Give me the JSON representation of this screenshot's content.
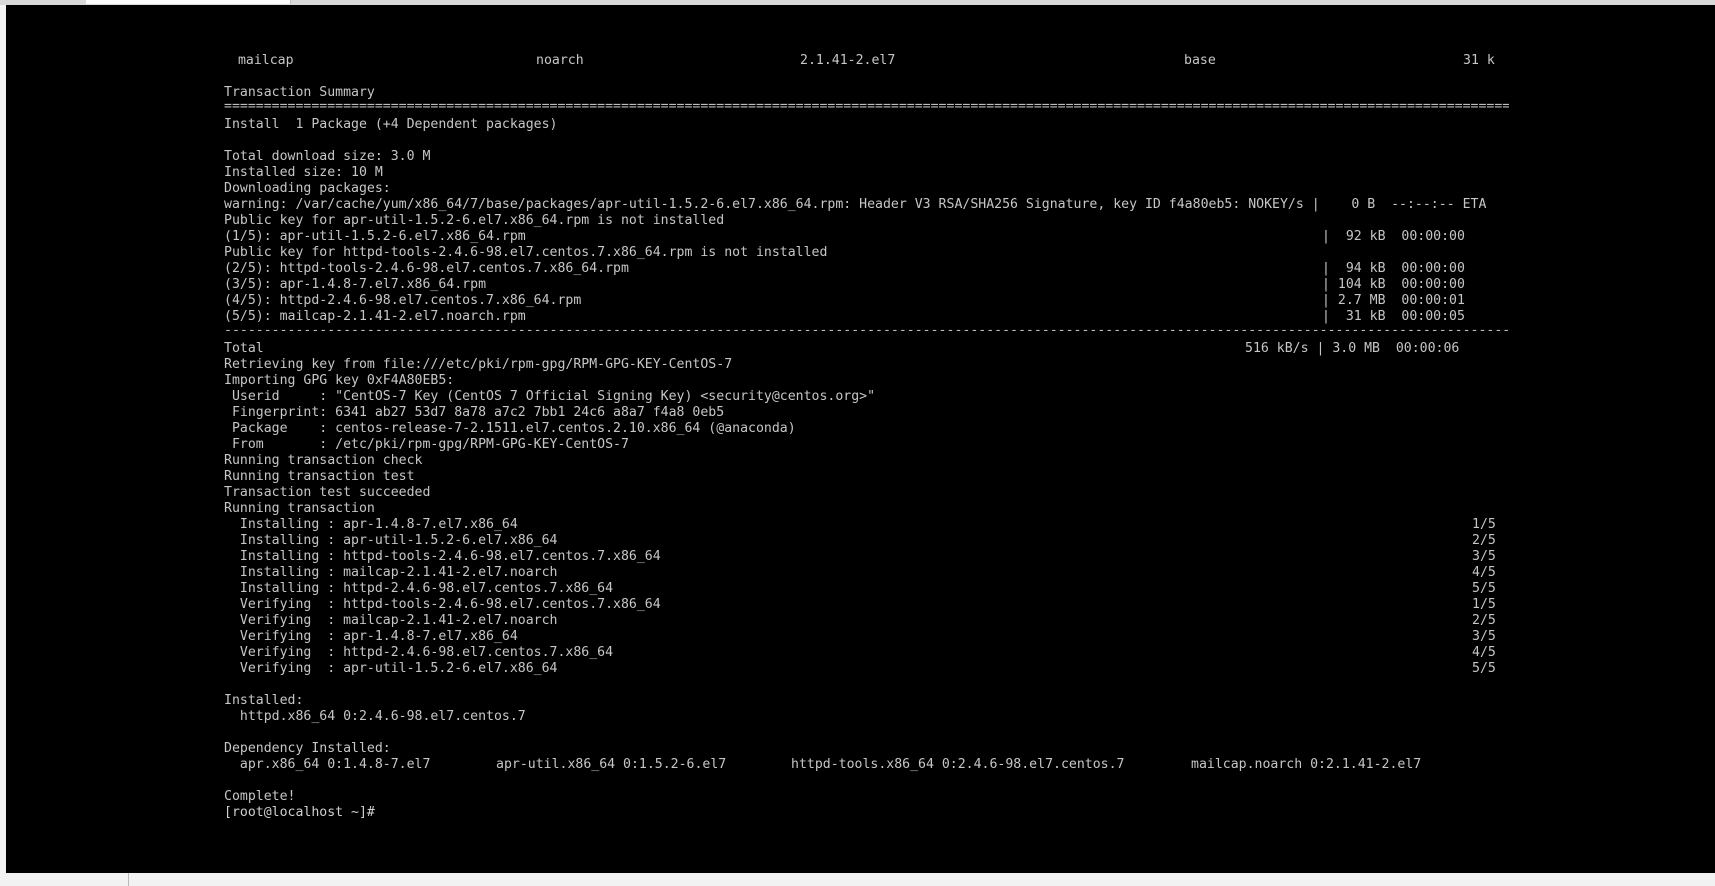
{
  "console": {
    "pkg_row": {
      "name": " mailcap",
      "arch": "noarch",
      "version": "2.1.41-2.el7",
      "repo": "base",
      "size": "31 k"
    },
    "transaction_summary": "Transaction Summary",
    "equals_rule": "==================================================================================================================================================================================================",
    "install_line": "Install  1 Package (+4 Dependent packages)",
    "total_download": "Total download size: 3.0 M",
    "installed_size": "Installed size: 10 M",
    "downloading": "Downloading packages:",
    "warning_line": "warning: /var/cache/yum/x86_64/7/base/packages/apr-util-1.5.2-6.el7.x86_64.rpm: Header V3 RSA/SHA256 Signature, key ID f4a80eb5: NOKEY/s |    0 B  --:--:-- ETA",
    "pubkey_apr_util": "Public key for apr-util-1.5.2-6.el7.x86_64.rpm is not installed",
    "pubkey_httpd_tools": "Public key for httpd-tools-2.4.6-98.el7.centos.7.x86_64.rpm is not installed",
    "downloads": [
      {
        "file": "(1/5): apr-util-1.5.2-6.el7.x86_64.rpm",
        "stat": "|  92 kB  00:00:00"
      },
      {
        "file": "(2/5): httpd-tools-2.4.6-98.el7.centos.7.x86_64.rpm",
        "stat": "|  94 kB  00:00:00"
      },
      {
        "file": "(3/5): apr-1.4.8-7.el7.x86_64.rpm",
        "stat": "| 104 kB  00:00:00"
      },
      {
        "file": "(4/5): httpd-2.4.6-98.el7.centos.7.x86_64.rpm",
        "stat": "| 2.7 MB  00:00:01"
      },
      {
        "file": "(5/5): mailcap-2.1.41-2.el7.noarch.rpm",
        "stat": "|  31 kB  00:00:05"
      }
    ],
    "dash_rule": "--------------------------------------------------------------------------------------------------------------------------------------------------------------------------------------------------",
    "total_label": "Total",
    "total_stat": "516 kB/s | 3.0 MB  00:00:06",
    "gpg_lines": [
      "Retrieving key from file:///etc/pki/rpm-gpg/RPM-GPG-KEY-CentOS-7",
      "Importing GPG key 0xF4A80EB5:",
      " Userid     : \"CentOS-7 Key (CentOS 7 Official Signing Key) <security@centos.org>\"",
      " Fingerprint: 6341 ab27 53d7 8a78 a7c2 7bb1 24c6 a8a7 f4a8 0eb5",
      " Package    : centos-release-7-2.1511.el7.centos.2.10.x86_64 (@anaconda)",
      " From       : /etc/pki/rpm-gpg/RPM-GPG-KEY-CentOS-7",
      "Running transaction check",
      "Running transaction test",
      "Transaction test succeeded",
      "Running transaction"
    ],
    "steps": [
      {
        "text": "  Installing : apr-1.4.8-7.el7.x86_64",
        "count": "1/5"
      },
      {
        "text": "  Installing : apr-util-1.5.2-6.el7.x86_64",
        "count": "2/5"
      },
      {
        "text": "  Installing : httpd-tools-2.4.6-98.el7.centos.7.x86_64",
        "count": "3/5"
      },
      {
        "text": "  Installing : mailcap-2.1.41-2.el7.noarch",
        "count": "4/5"
      },
      {
        "text": "  Installing : httpd-2.4.6-98.el7.centos.7.x86_64",
        "count": "5/5"
      },
      {
        "text": "  Verifying  : httpd-tools-2.4.6-98.el7.centos.7.x86_64",
        "count": "1/5"
      },
      {
        "text": "  Verifying  : mailcap-2.1.41-2.el7.noarch",
        "count": "2/5"
      },
      {
        "text": "  Verifying  : apr-1.4.8-7.el7.x86_64",
        "count": "3/5"
      },
      {
        "text": "  Verifying  : httpd-2.4.6-98.el7.centos.7.x86_64",
        "count": "4/5"
      },
      {
        "text": "  Verifying  : apr-util-1.5.2-6.el7.x86_64",
        "count": "5/5"
      }
    ],
    "installed_header": "Installed:",
    "installed_pkg": "  httpd.x86_64 0:2.4.6-98.el7.centos.7",
    "dep_header": "Dependency Installed:",
    "deps": [
      "  apr.x86_64 0:1.4.8-7.el7",
      "apr-util.x86_64 0:1.5.2-6.el7",
      "httpd-tools.x86_64 0:2.4.6-98.el7.centos.7",
      "mailcap.noarch 0:2.1.41-2.el7"
    ],
    "complete": "Complete!",
    "prompt": "[root@localhost ~]#"
  }
}
